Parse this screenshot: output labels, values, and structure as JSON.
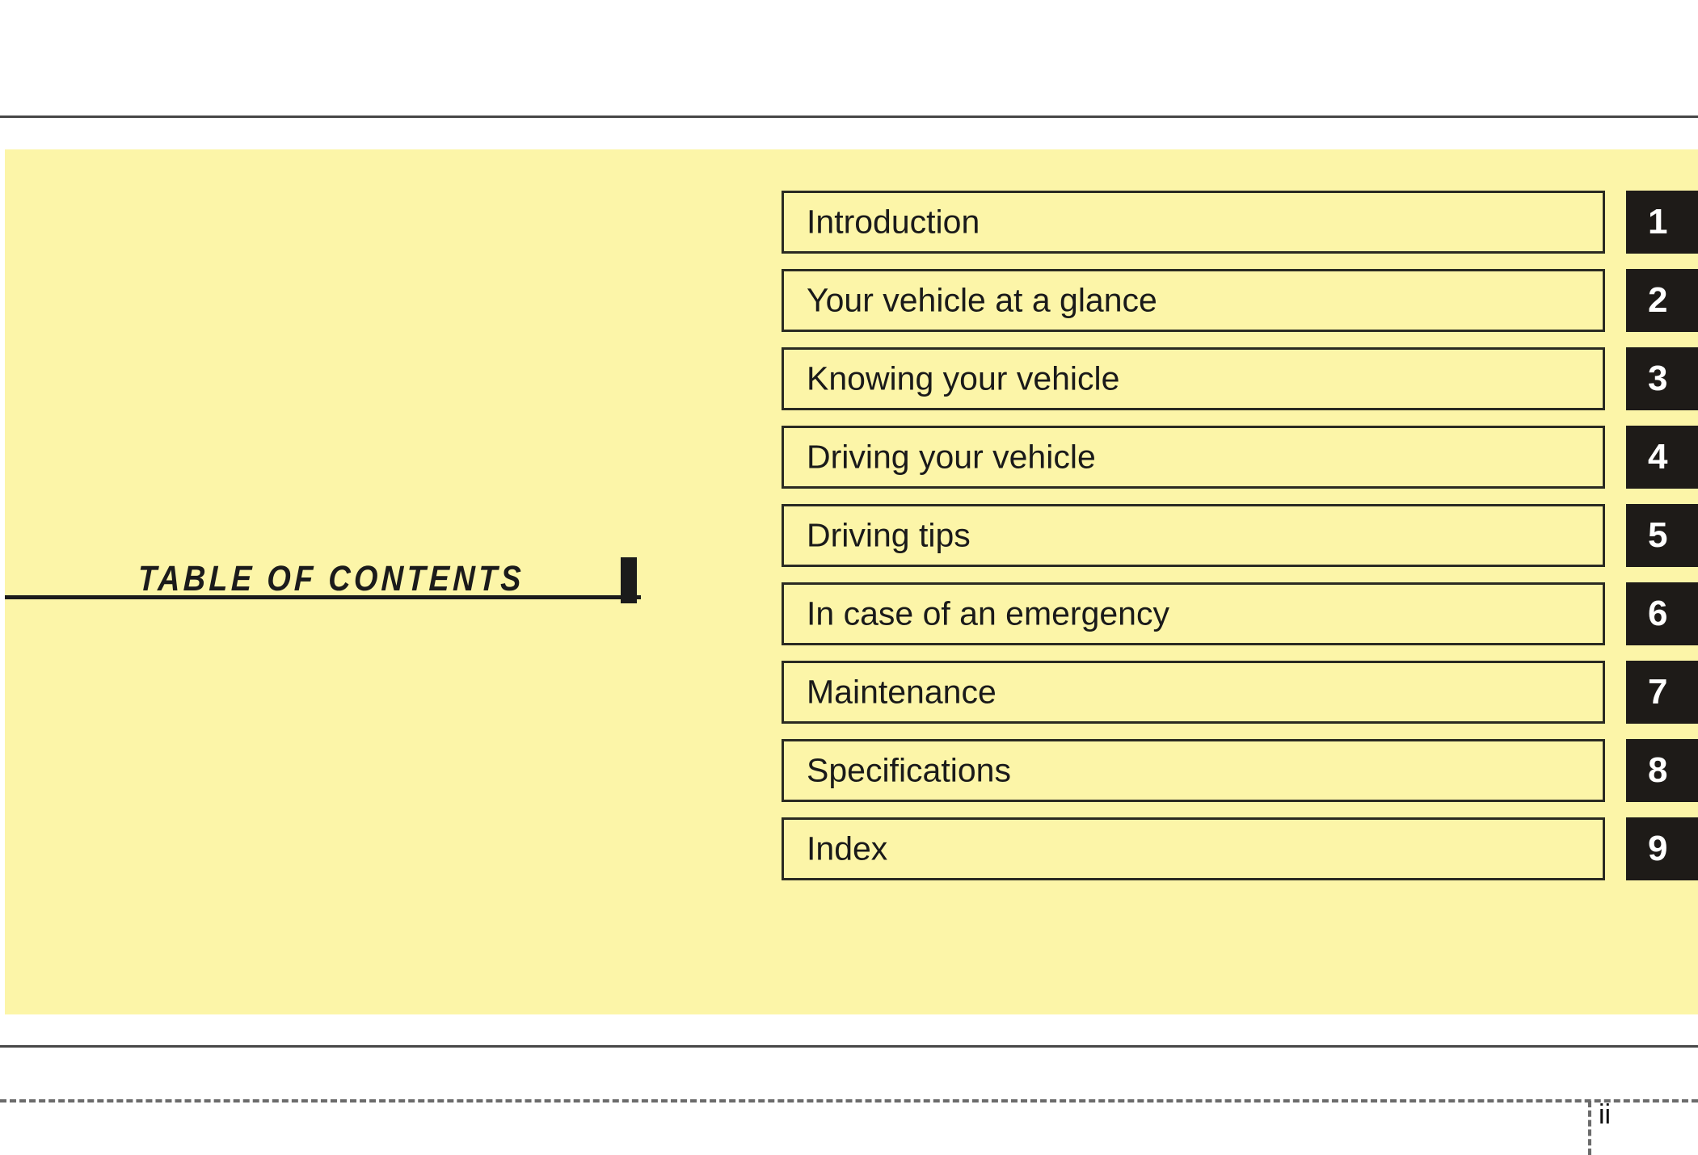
{
  "document": {
    "section_title": "TABLE OF CONTENTS",
    "page_number": "ii"
  },
  "colors": {
    "panel_background": "#FCF5A8",
    "box_border": "#2A2A22",
    "tab_background": "#1E1B18",
    "tab_number": "#FFFFFF",
    "rule": "#474747",
    "text": "#1A1A1A"
  },
  "contents": {
    "items": [
      {
        "label": "Introduction",
        "tab": "1"
      },
      {
        "label": "Your vehicle at a glance",
        "tab": "2"
      },
      {
        "label": "Knowing your vehicle",
        "tab": "3"
      },
      {
        "label": "Driving your vehicle",
        "tab": "4"
      },
      {
        "label": "Driving tips",
        "tab": "5"
      },
      {
        "label": "In case of an emergency",
        "tab": "6"
      },
      {
        "label": "Maintenance",
        "tab": "7"
      },
      {
        "label": "Specifications",
        "tab": "8"
      },
      {
        "label": "Index",
        "tab": "9"
      }
    ]
  }
}
